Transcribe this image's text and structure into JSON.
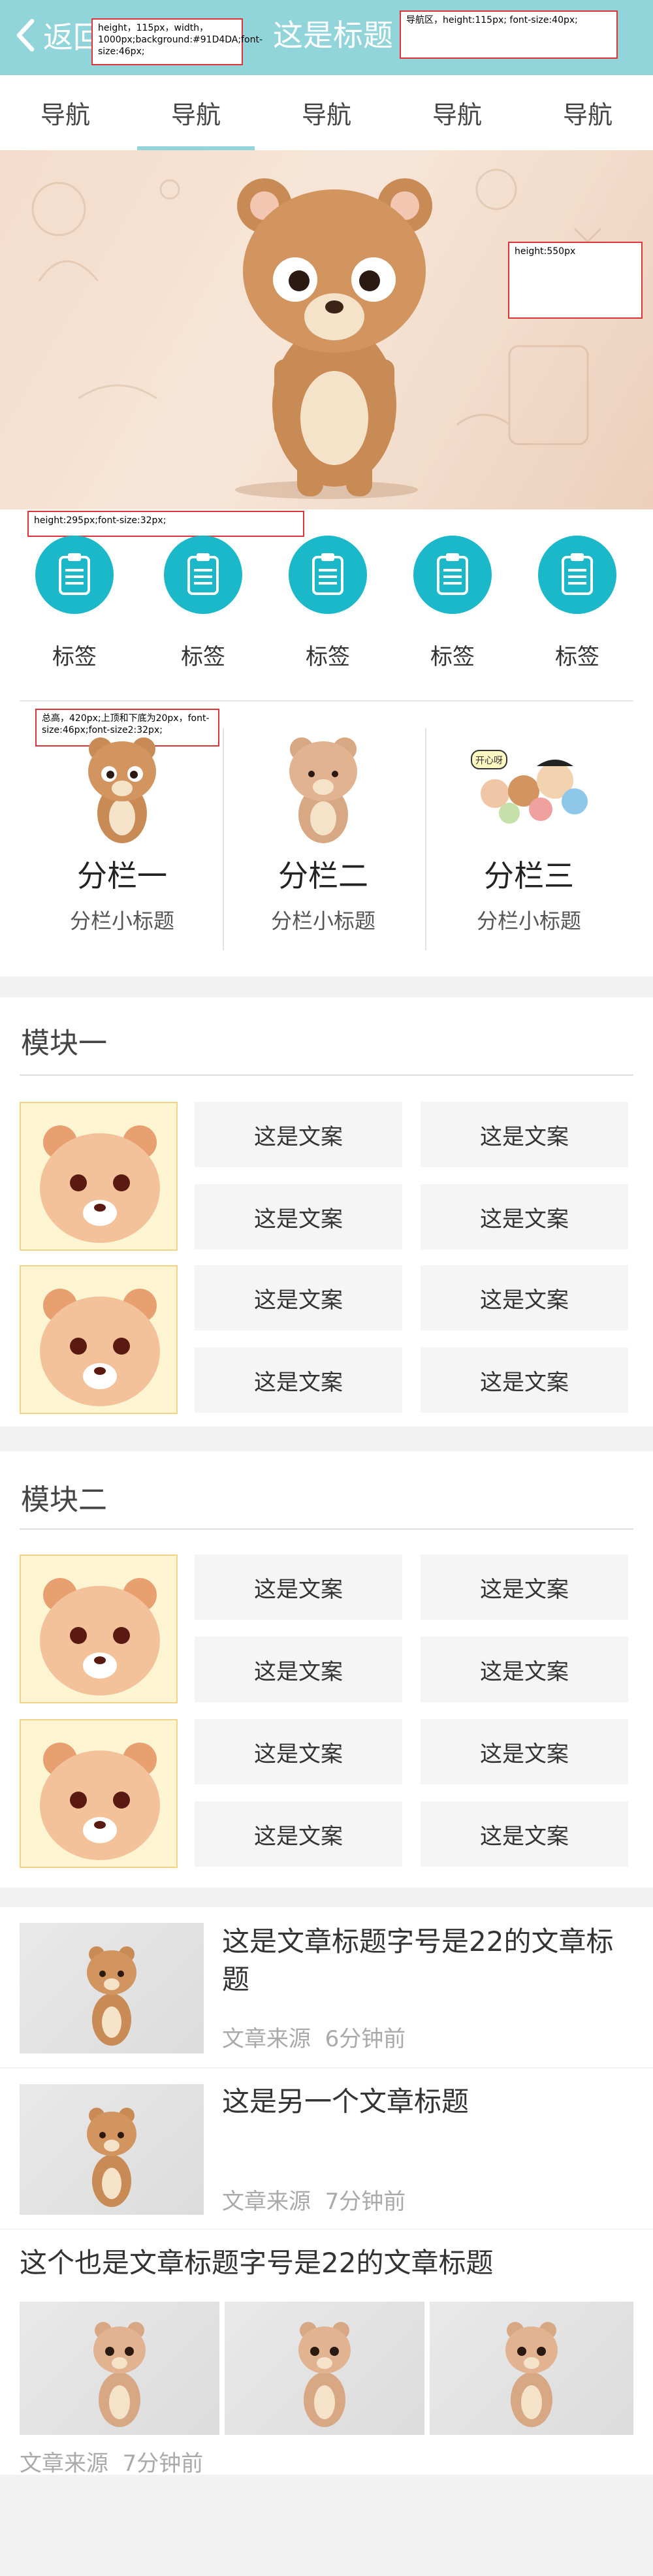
{
  "header": {
    "back_label": "返回",
    "title": "这是标题"
  },
  "notes": {
    "header_spec": "height，115px，width，1000px;background:#91D4DA;font-size:46px;",
    "nav_spec": "导航区，height:115px; font-size:40px;",
    "banner_spec": "height:550px",
    "icons_spec": "height:295px;font-size:32px;",
    "cols_spec": "总高，420px;上顶和下底为20px，font-size:46px;font-size2:32px;"
  },
  "nav": {
    "items": [
      "导航",
      "导航",
      "导航",
      "导航",
      "导航"
    ],
    "active_index": 1
  },
  "icons": {
    "items": [
      "标签",
      "标签",
      "标签",
      "标签",
      "标签"
    ]
  },
  "columns": [
    {
      "title": "分栏一",
      "subtitle": "分栏小标题"
    },
    {
      "title": "分栏二",
      "subtitle": "分栏小标题"
    },
    {
      "title": "分栏三",
      "subtitle": "分栏小标题"
    }
  ],
  "sticker_text": "开心呀",
  "module1": {
    "title": "模块一",
    "cells": [
      "这是文案",
      "这是文案",
      "这是文案",
      "这是文案",
      "这是文案",
      "这是文案",
      "这是文案",
      "这是文案"
    ]
  },
  "module2": {
    "title": "模块二",
    "cells": [
      "这是文案",
      "这是文案",
      "这是文案",
      "这是文案",
      "这是文案",
      "这是文案",
      "这是文案",
      "这是文案"
    ]
  },
  "articles": [
    {
      "title": "这是文章标题字号是22的文章标题",
      "source": "文章来源",
      "time": "6分钟前"
    },
    {
      "title": "这是另一个文章标题",
      "source": "文章来源",
      "time": "7分钟前"
    },
    {
      "title": "这个也是文章标题字号是22的文章标题",
      "source": "文章来源",
      "time": "7分钟前"
    }
  ],
  "colors": {
    "brand": "#91D4DA",
    "icon_circle": "#1AB8C8",
    "page_bg": "#F2F2F2"
  }
}
